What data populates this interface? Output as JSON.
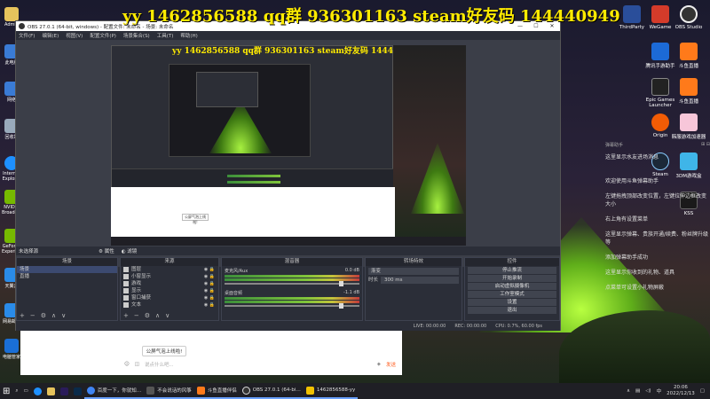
{
  "overlay_title": "yy 1462856588 qq群 936301163 steam好友码 144440949",
  "desktop": {
    "left_icons": [
      "Admin",
      "此电脑",
      "网络",
      "回收站",
      "控制面板",
      "Internet Explorer",
      "NVIDIA Broadcast",
      "GeForce Experience",
      "天翼云",
      "网易邮箱",
      "电脑管家"
    ],
    "right_icons": [
      {
        "label": "ThirdParty",
        "color": "#2a4e9a"
      },
      {
        "label": "WeGame",
        "color": "#d43b2a"
      },
      {
        "label": "OBS Studio",
        "color": "#333333"
      },
      {
        "label": "腾讯手游助手",
        "color": "#1c6ad6"
      },
      {
        "label": "斗鱼直播",
        "color": "#ff7a1a"
      },
      {
        "label": "Epic Games Launcher",
        "color": "#222222"
      },
      {
        "label": "斗鱼直播",
        "color": "#ff7a1a"
      },
      {
        "label": "Origin",
        "color": "#f25c05"
      },
      {
        "label": "韩服游戏加速器",
        "color": "#f7c6d9"
      },
      {
        "label": "Steam",
        "color": "#1b2838"
      },
      {
        "label": "3DM游戏盒",
        "color": "#3fb5e8"
      },
      {
        "label": "KSS",
        "color": "#1a1a1a"
      }
    ]
  },
  "chat": {
    "header_left": "弹幕助手",
    "header_right": "⊞ ⊟",
    "lines": [
      "这里显示水友进场消息",
      "欢迎使用斗鱼弹幕助手",
      "左键拖拽顶部改变位置，左键拉伸边框改变大小",
      "右上角有设置菜单",
      "这里显示弹幕、贵族开通/续费、粉丝牌升级等",
      "添加弹幕助手成功",
      "这里显示你收到的礼物、道具",
      "点菜单可设置小礼物屏蔽"
    ]
  },
  "obs": {
    "title": "OBS 27.0.1 (64-bit, windows) - 配置文件: 未命名 - 场景: 未命名",
    "menus": [
      "文件(F)",
      "编辑(E)",
      "视图(V)",
      "配置文件(P)",
      "场景集合(S)",
      "工具(T)",
      "帮助(H)"
    ],
    "bottom_bar": {
      "no_source": "未选择源",
      "properties": "属性",
      "filters": "滤镜"
    },
    "docks": {
      "scenes": {
        "title": "场景",
        "items": [
          "场景",
          "直播"
        ]
      },
      "sources": {
        "title": "来源",
        "items": [
          "图层",
          "小窗显示",
          "游戏",
          "显示",
          "窗口捕获",
          "文本"
        ]
      },
      "mixer": {
        "title": "混音器",
        "tracks": [
          {
            "name": "麦克风/Aux",
            "db": "0.0 dB"
          },
          {
            "name": "桌面音频",
            "db": "-1.1 dB"
          }
        ]
      },
      "transitions": {
        "title": "转场特效",
        "type": "渐变",
        "duration_label": "时长",
        "duration": "300 ms"
      },
      "controls": {
        "title": "控件",
        "buttons": [
          "停止推流",
          "开始录制",
          "启动虚拟摄像机",
          "工作室模式",
          "设置",
          "退出"
        ]
      }
    },
    "status": {
      "live": "LIVE: 00:00:00",
      "rec": "REC: 00:00:00",
      "cpu": "CPU: 0.7%, 60.00 fps"
    }
  },
  "message_area": {
    "danmu_tip": "公屏气泡上线啦!",
    "placeholder": "说点什么吧...",
    "send_label": "发送"
  },
  "taskbar": {
    "items": [
      {
        "label": "百度一下，你就知…",
        "color": "#3f85f4"
      },
      {
        "label": "不会说话的风筝",
        "color": "#555555"
      },
      {
        "label": "斗鱼直播伴侣",
        "color": "#ff7a1a"
      },
      {
        "label": "OBS 27.0.1 (64-bi…",
        "color": "#333333"
      },
      {
        "label": "1462856588-yy",
        "color": "#f2c200"
      }
    ],
    "time": "20:06",
    "date": "2022/12/13"
  }
}
